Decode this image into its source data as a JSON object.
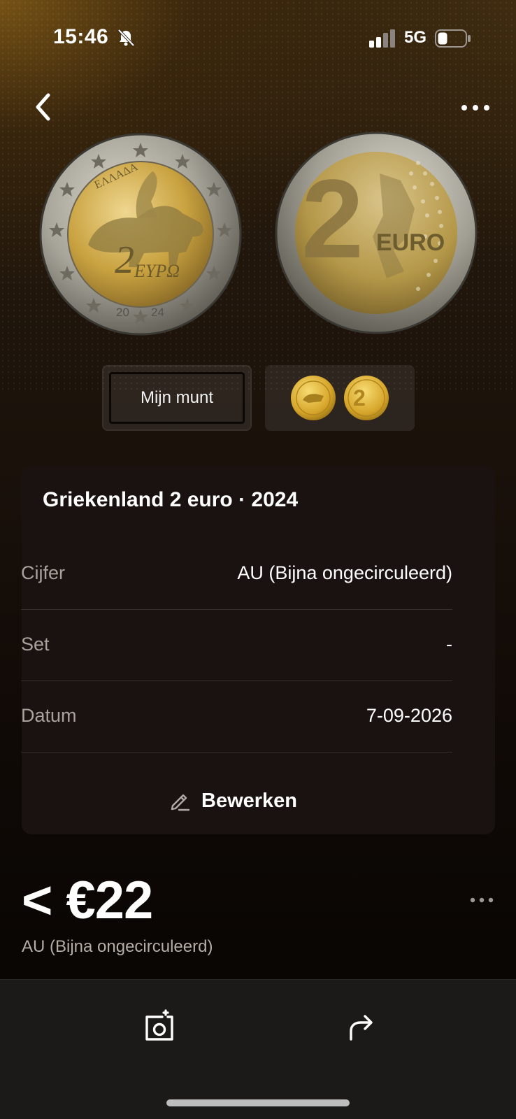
{
  "status_bar": {
    "time": "15:46",
    "network": "5G",
    "icons": [
      "bell-off-icon",
      "signal-icon",
      "battery-icon"
    ]
  },
  "nav": {
    "back_icon": "chevron-left-icon",
    "more_icon": "more-horizontal-icon"
  },
  "coin_images": {
    "front_text": "2 EYPΩ",
    "front_country": "ΕΛΛΑΔΑ",
    "front_year": "20 24",
    "back_text": "2 EURO"
  },
  "view_toggle": {
    "mine_label": "Mijn munt"
  },
  "details": {
    "title": "Griekenland 2 euro · 2024",
    "rows": [
      {
        "label": "Cijfer",
        "value": "AU (Bijna ongecirculeerd)"
      },
      {
        "label": "Set",
        "value": "-"
      },
      {
        "label": "Datum",
        "value": "7-09-2026"
      }
    ],
    "edit_label": "Bewerken"
  },
  "price": {
    "value": "< €22",
    "grade": "AU (Bijna ongecirculeerd)"
  },
  "bottom_bar": {
    "icons": [
      "camera-icon",
      "share-icon"
    ]
  },
  "colors": {
    "background_top": "#2b1d0d",
    "background_bottom": "#050302",
    "card": "#1a1210",
    "muted_text": "#a9a19c",
    "coin_gold": "#c9a240",
    "coin_silver": "#a7a49a"
  }
}
